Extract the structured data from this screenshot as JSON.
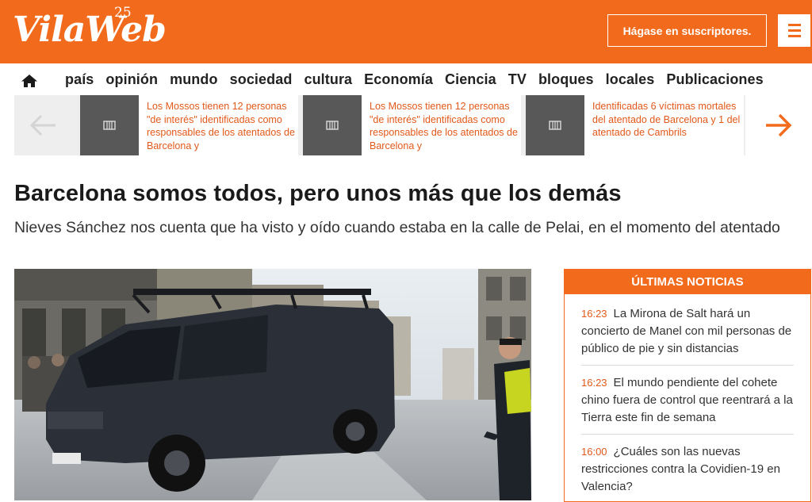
{
  "header": {
    "logo_text": "VilaWeb",
    "logo_sup": "25",
    "subscribe_label": "Hágase en suscriptores.",
    "menu_icon": "hamburger-menu-icon",
    "brand_color": "#f26a1b"
  },
  "nav": {
    "home_icon": "home-icon",
    "items": [
      {
        "label": "país"
      },
      {
        "label": "opinión"
      },
      {
        "label": "mundo"
      },
      {
        "label": "sociedad"
      },
      {
        "label": "cultura"
      },
      {
        "label": "Economía"
      },
      {
        "label": "Ciencia"
      },
      {
        "label": "TV"
      },
      {
        "label": "bloques"
      },
      {
        "label": "locales"
      },
      {
        "label": "Publicaciones"
      }
    ]
  },
  "carousel": {
    "prev_icon": "arrow-left-icon",
    "next_icon": "arrow-right-icon",
    "items": [
      {
        "text": "Los Mossos tienen 12 personas \"de interés\" identificadas como responsables de los atentados de Barcelona y"
      },
      {
        "text": "Los Mossos tienen 12 personas \"de interés\" identificadas como responsables de los atentados de Barcelona y"
      },
      {
        "text": "Identificadas 6 víctimas mortales del atentado de Barcelona y 1 del atentado de Cambrils"
      }
    ]
  },
  "article": {
    "title": "Barcelona somos todos, pero unos más que los demás",
    "subtitle": "Nieves Sánchez nos cuenta que ha visto y oído cuando estaba en la calle de Pelai, en el momento del atentado"
  },
  "latest": {
    "heading": "ÚLTIMAS NOTICIAS",
    "items": [
      {
        "time": "16:23",
        "text": "La Mirona de Salt hará un concierto de Manel con mil personas de público de pie y sin distancias"
      },
      {
        "time": "16:23",
        "text": "El mundo pendiente del cohete chino fuera de control que reentrará a la Tierra este fin de semana"
      },
      {
        "time": "16:00",
        "text": "¿Cuáles son las nuevas restricciones contra la Covidien-19 en Valencia?"
      }
    ]
  }
}
